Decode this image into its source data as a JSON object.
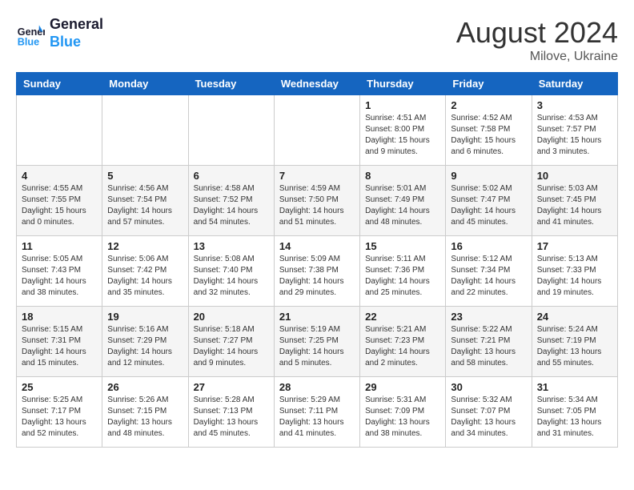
{
  "header": {
    "logo_line1": "General",
    "logo_line2": "Blue",
    "title": "August 2024",
    "subtitle": "Milove, Ukraine"
  },
  "weekdays": [
    "Sunday",
    "Monday",
    "Tuesday",
    "Wednesday",
    "Thursday",
    "Friday",
    "Saturday"
  ],
  "weeks": [
    [
      {
        "day": "",
        "info": ""
      },
      {
        "day": "",
        "info": ""
      },
      {
        "day": "",
        "info": ""
      },
      {
        "day": "",
        "info": ""
      },
      {
        "day": "1",
        "info": "Sunrise: 4:51 AM\nSunset: 8:00 PM\nDaylight: 15 hours\nand 9 minutes."
      },
      {
        "day": "2",
        "info": "Sunrise: 4:52 AM\nSunset: 7:58 PM\nDaylight: 15 hours\nand 6 minutes."
      },
      {
        "day": "3",
        "info": "Sunrise: 4:53 AM\nSunset: 7:57 PM\nDaylight: 15 hours\nand 3 minutes."
      }
    ],
    [
      {
        "day": "4",
        "info": "Sunrise: 4:55 AM\nSunset: 7:55 PM\nDaylight: 15 hours\nand 0 minutes."
      },
      {
        "day": "5",
        "info": "Sunrise: 4:56 AM\nSunset: 7:54 PM\nDaylight: 14 hours\nand 57 minutes."
      },
      {
        "day": "6",
        "info": "Sunrise: 4:58 AM\nSunset: 7:52 PM\nDaylight: 14 hours\nand 54 minutes."
      },
      {
        "day": "7",
        "info": "Sunrise: 4:59 AM\nSunset: 7:50 PM\nDaylight: 14 hours\nand 51 minutes."
      },
      {
        "day": "8",
        "info": "Sunrise: 5:01 AM\nSunset: 7:49 PM\nDaylight: 14 hours\nand 48 minutes."
      },
      {
        "day": "9",
        "info": "Sunrise: 5:02 AM\nSunset: 7:47 PM\nDaylight: 14 hours\nand 45 minutes."
      },
      {
        "day": "10",
        "info": "Sunrise: 5:03 AM\nSunset: 7:45 PM\nDaylight: 14 hours\nand 41 minutes."
      }
    ],
    [
      {
        "day": "11",
        "info": "Sunrise: 5:05 AM\nSunset: 7:43 PM\nDaylight: 14 hours\nand 38 minutes."
      },
      {
        "day": "12",
        "info": "Sunrise: 5:06 AM\nSunset: 7:42 PM\nDaylight: 14 hours\nand 35 minutes."
      },
      {
        "day": "13",
        "info": "Sunrise: 5:08 AM\nSunset: 7:40 PM\nDaylight: 14 hours\nand 32 minutes."
      },
      {
        "day": "14",
        "info": "Sunrise: 5:09 AM\nSunset: 7:38 PM\nDaylight: 14 hours\nand 29 minutes."
      },
      {
        "day": "15",
        "info": "Sunrise: 5:11 AM\nSunset: 7:36 PM\nDaylight: 14 hours\nand 25 minutes."
      },
      {
        "day": "16",
        "info": "Sunrise: 5:12 AM\nSunset: 7:34 PM\nDaylight: 14 hours\nand 22 minutes."
      },
      {
        "day": "17",
        "info": "Sunrise: 5:13 AM\nSunset: 7:33 PM\nDaylight: 14 hours\nand 19 minutes."
      }
    ],
    [
      {
        "day": "18",
        "info": "Sunrise: 5:15 AM\nSunset: 7:31 PM\nDaylight: 14 hours\nand 15 minutes."
      },
      {
        "day": "19",
        "info": "Sunrise: 5:16 AM\nSunset: 7:29 PM\nDaylight: 14 hours\nand 12 minutes."
      },
      {
        "day": "20",
        "info": "Sunrise: 5:18 AM\nSunset: 7:27 PM\nDaylight: 14 hours\nand 9 minutes."
      },
      {
        "day": "21",
        "info": "Sunrise: 5:19 AM\nSunset: 7:25 PM\nDaylight: 14 hours\nand 5 minutes."
      },
      {
        "day": "22",
        "info": "Sunrise: 5:21 AM\nSunset: 7:23 PM\nDaylight: 14 hours\nand 2 minutes."
      },
      {
        "day": "23",
        "info": "Sunrise: 5:22 AM\nSunset: 7:21 PM\nDaylight: 13 hours\nand 58 minutes."
      },
      {
        "day": "24",
        "info": "Sunrise: 5:24 AM\nSunset: 7:19 PM\nDaylight: 13 hours\nand 55 minutes."
      }
    ],
    [
      {
        "day": "25",
        "info": "Sunrise: 5:25 AM\nSunset: 7:17 PM\nDaylight: 13 hours\nand 52 minutes."
      },
      {
        "day": "26",
        "info": "Sunrise: 5:26 AM\nSunset: 7:15 PM\nDaylight: 13 hours\nand 48 minutes."
      },
      {
        "day": "27",
        "info": "Sunrise: 5:28 AM\nSunset: 7:13 PM\nDaylight: 13 hours\nand 45 minutes."
      },
      {
        "day": "28",
        "info": "Sunrise: 5:29 AM\nSunset: 7:11 PM\nDaylight: 13 hours\nand 41 minutes."
      },
      {
        "day": "29",
        "info": "Sunrise: 5:31 AM\nSunset: 7:09 PM\nDaylight: 13 hours\nand 38 minutes."
      },
      {
        "day": "30",
        "info": "Sunrise: 5:32 AM\nSunset: 7:07 PM\nDaylight: 13 hours\nand 34 minutes."
      },
      {
        "day": "31",
        "info": "Sunrise: 5:34 AM\nSunset: 7:05 PM\nDaylight: 13 hours\nand 31 minutes."
      }
    ]
  ]
}
